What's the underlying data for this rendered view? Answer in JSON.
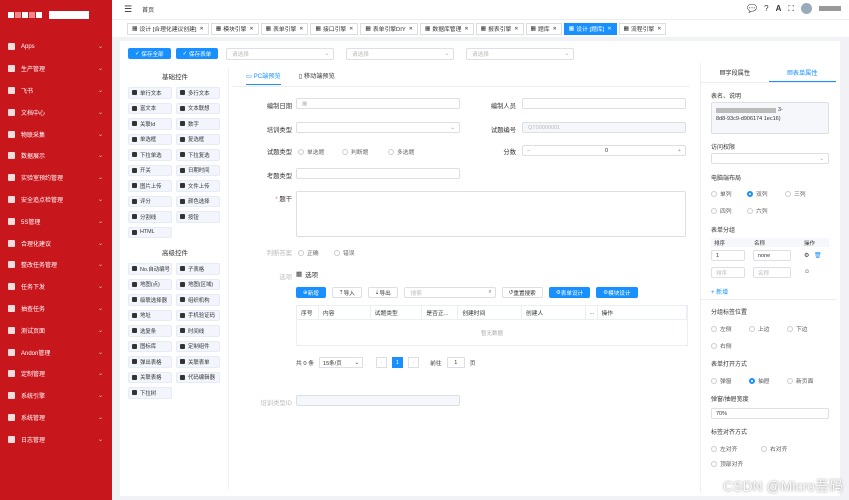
{
  "topbar": {
    "home": "首页",
    "icons": [
      "message-icon",
      "help-icon",
      "translate-icon",
      "fullscreen-icon"
    ]
  },
  "tabs": [
    {
      "label": "设计 [合理化建议创建]"
    },
    {
      "label": "模块引擎"
    },
    {
      "label": "表单引擎"
    },
    {
      "label": "接口引擎"
    },
    {
      "label": "表单引擎DIY"
    },
    {
      "label": "数据库管理"
    },
    {
      "label": "报表引擎"
    },
    {
      "label": "题库"
    },
    {
      "label": "设计 [题库]",
      "active": true
    },
    {
      "label": "流程引擎"
    }
  ],
  "sidebar": {
    "items": [
      {
        "label": "Apps"
      },
      {
        "label": "生产管理"
      },
      {
        "label": "飞书"
      },
      {
        "label": "文档中心"
      },
      {
        "label": "物联采集"
      },
      {
        "label": "数据展示"
      },
      {
        "label": "实验室预约管理"
      },
      {
        "label": "安全追点检管理"
      },
      {
        "label": "5S管理"
      },
      {
        "label": "合理化建议"
      },
      {
        "label": "整改任务管理"
      },
      {
        "label": "任务下发"
      },
      {
        "label": "抽查任务"
      },
      {
        "label": "测试页面"
      },
      {
        "label": "Andon管理"
      },
      {
        "label": "定制管理"
      },
      {
        "label": "系统引擎"
      },
      {
        "label": "系统管理"
      },
      {
        "label": "日志管理"
      }
    ]
  },
  "toolbar": {
    "save_all": "保存全部",
    "save_form": "保存表单",
    "select1": "请选择",
    "select2": "请选择",
    "select3": "请选择"
  },
  "palette": {
    "basic_title": "基础控件",
    "basic": [
      "单行文本",
      "多行文本",
      "富文本",
      "文本联想",
      "关联Id",
      "数字",
      "单选框",
      "复选框",
      "下拉单选",
      "下拉复选",
      "开关",
      "日期时间",
      "图片上传",
      "文件上传",
      "评分",
      "颜色选择",
      "分割线",
      "按钮",
      "HTML"
    ],
    "adv_title": "高级控件",
    "advanced": [
      "No.自动编号",
      "子表格",
      "地图(点)",
      "地图(区域)",
      "级联选择器",
      "组织机构",
      "地址",
      "手机验证码",
      "选复条",
      "时间线",
      "图标库",
      "定制组件",
      "弹出表格",
      "关联表单",
      "关联表格",
      "代码编辑器",
      "下拉树"
    ]
  },
  "view_tabs": {
    "pc": "PC端预览",
    "mobile": "移动端预览"
  },
  "form": {
    "edit_date": "编制日期",
    "editor": "编制人员",
    "train_type": "培训类型",
    "qnum": "试题编号",
    "qnum_val": "QT00000001",
    "qtype": "试题类型",
    "qtype_opts": [
      "单选题",
      "判断题",
      "多选题"
    ],
    "score": "分数",
    "score_val": "0",
    "exam_type": "考题类型",
    "stem": "题干",
    "answer": "判断答案",
    "answer_opts": [
      "正确",
      "错误"
    ],
    "options": "选项",
    "qtype_id": "培训类型ID"
  },
  "options_table": {
    "title": "选项",
    "buttons": {
      "add": "新增",
      "import": "导入",
      "export": "导出",
      "reset": "重置搜索",
      "design": "表单设计",
      "tpl": "模块设计"
    },
    "columns": [
      "序号",
      "内容",
      "试题类型",
      "是否正...",
      "创建时间",
      "创建人",
      "...",
      "操作"
    ],
    "empty": "暂无数据",
    "pager": {
      "total": "共 0 条",
      "size": "15条/页",
      "page": "1",
      "goto": "前往",
      "goto_val": "1",
      "unit": "页"
    }
  },
  "rpanel": {
    "tab_field": "字段属性",
    "tab_form": "表单属性",
    "name_label": "表名、说明",
    "name_val_tail": "3-",
    "name_val_line2": "8d8-93c9-d906174 1ec16)",
    "access": "访问权限",
    "layout": "电脑端布局",
    "layout_opts": [
      "单列",
      "双列",
      "三列",
      "四列",
      "六列"
    ],
    "group": "表单分组",
    "group_cols": [
      "排序",
      "名称",
      "操作"
    ],
    "group_order": "1",
    "group_name": "none",
    "group_ph1": "排序",
    "group_ph2": "名称",
    "add": "+ 新增",
    "label_pos": "分组标签位置",
    "label_pos_opts": [
      "左侧",
      "上边",
      "下边",
      "右侧"
    ],
    "open_mode": "表单打开方式",
    "open_opts": [
      "弹窗",
      "抽屉",
      "新页面"
    ],
    "width_label": "弹窗/抽屉宽度",
    "width_val": "70%",
    "align_label": "标签对齐方式",
    "align_opts": [
      "左对齐",
      "右对齐",
      "顶部对齐"
    ],
    "watermark": "CSDN @Micro吾码"
  }
}
